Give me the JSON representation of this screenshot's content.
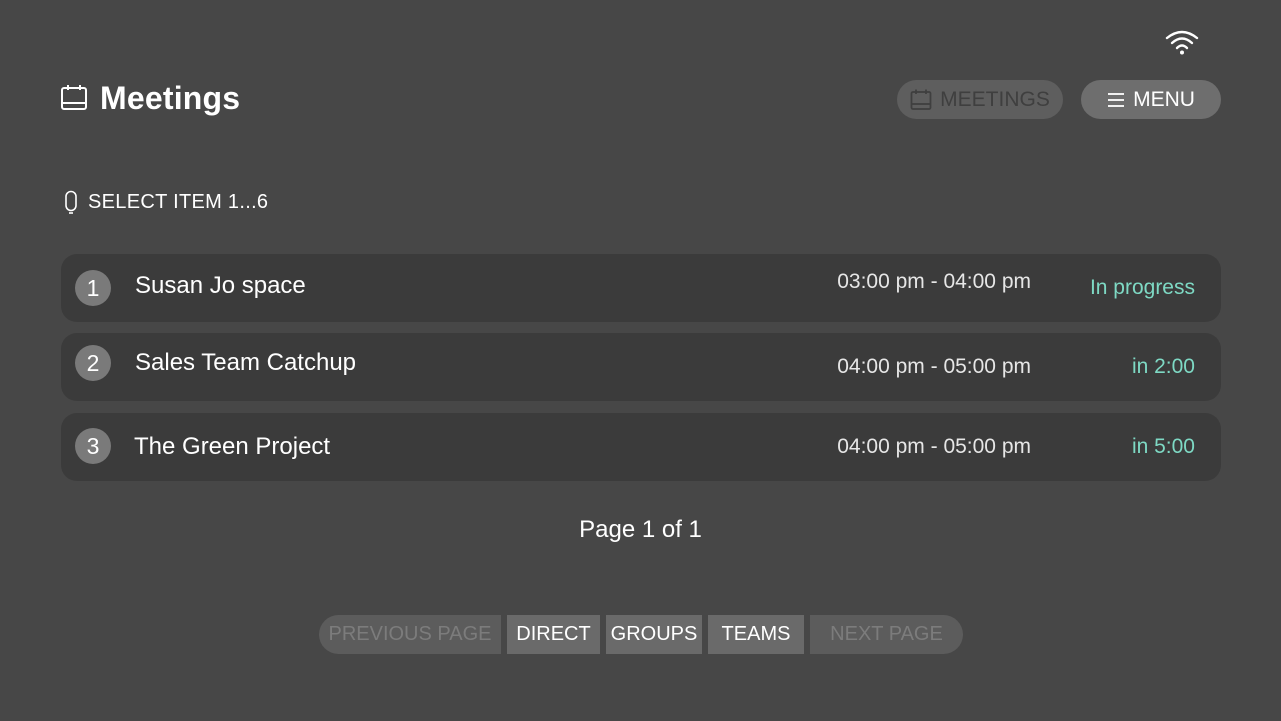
{
  "status_bar": {
    "wifi_icon": "wifi-icon"
  },
  "header": {
    "title": "Meetings",
    "title_icon": "calendar-icon",
    "meetings_button": "MEETINGS",
    "menu_button": "MENU"
  },
  "hint": {
    "text": "SELECT ITEM 1...6",
    "icon": "remote-icon"
  },
  "meetings": [
    {
      "number": "1",
      "name": "Susan Jo space",
      "time": "03:00 pm - 04:00 pm",
      "status": "In progress"
    },
    {
      "number": "2",
      "name": "Sales Team Catchup",
      "time": "04:00 pm - 05:00 pm",
      "status": "in 2:00"
    },
    {
      "number": "3",
      "name": "The Green Project",
      "time": "04:00 pm - 05:00 pm",
      "status": "in 5:00"
    }
  ],
  "pager": {
    "page_info": "Page 1 of 1"
  },
  "bottom_nav": {
    "previous": "PREVIOUS PAGE",
    "direct": "DIRECT",
    "groups": "GROUPS",
    "teams": "TEAMS",
    "next": "NEXT PAGE"
  },
  "colors": {
    "background": "#474747",
    "row_background": "#3b3b3b",
    "status_accent": "#7ed9c4"
  }
}
